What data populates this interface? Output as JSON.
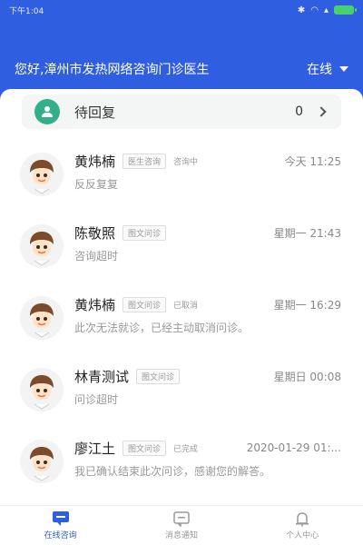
{
  "status_bar": {
    "time": "下午1:04"
  },
  "header": {
    "greeting": "您好,漳州市发热网络咨询门诊医生",
    "status": "在线"
  },
  "pending": {
    "title": "待回复",
    "count": "0"
  },
  "consultations": [
    {
      "name": "黄炜楠",
      "tag": "医生咨询",
      "state": "咨询中",
      "time": "今天 11:25",
      "message": "反反复复"
    },
    {
      "name": "陈敬照",
      "tag": "图文问诊",
      "state": "",
      "time": "星期一 21:43",
      "message": "咨询超时"
    },
    {
      "name": "黄炜楠",
      "tag": "图文问诊",
      "state": "已取消",
      "time": "星期一 16:29",
      "message": "此次无法就诊，已经主动取消问诊。"
    },
    {
      "name": "林青测试",
      "tag": "图文问诊",
      "state": "",
      "time": "星期日 00:08",
      "message": "问诊超时"
    },
    {
      "name": "廖江土",
      "tag": "图文问诊",
      "state": "已完成",
      "time": "2020-01-29 01:...",
      "message": "我已确认结束此次问诊，感谢您的解答。"
    }
  ],
  "tabs": [
    {
      "label": "在线咨询",
      "icon": "chat-icon"
    },
    {
      "label": "消息通知",
      "icon": "message-icon"
    },
    {
      "label": "个人中心",
      "icon": "bell-icon"
    }
  ],
  "colors": {
    "brand": "#2f5fe0",
    "pending_icon": "#33b08a",
    "battery": "#46d36b"
  }
}
